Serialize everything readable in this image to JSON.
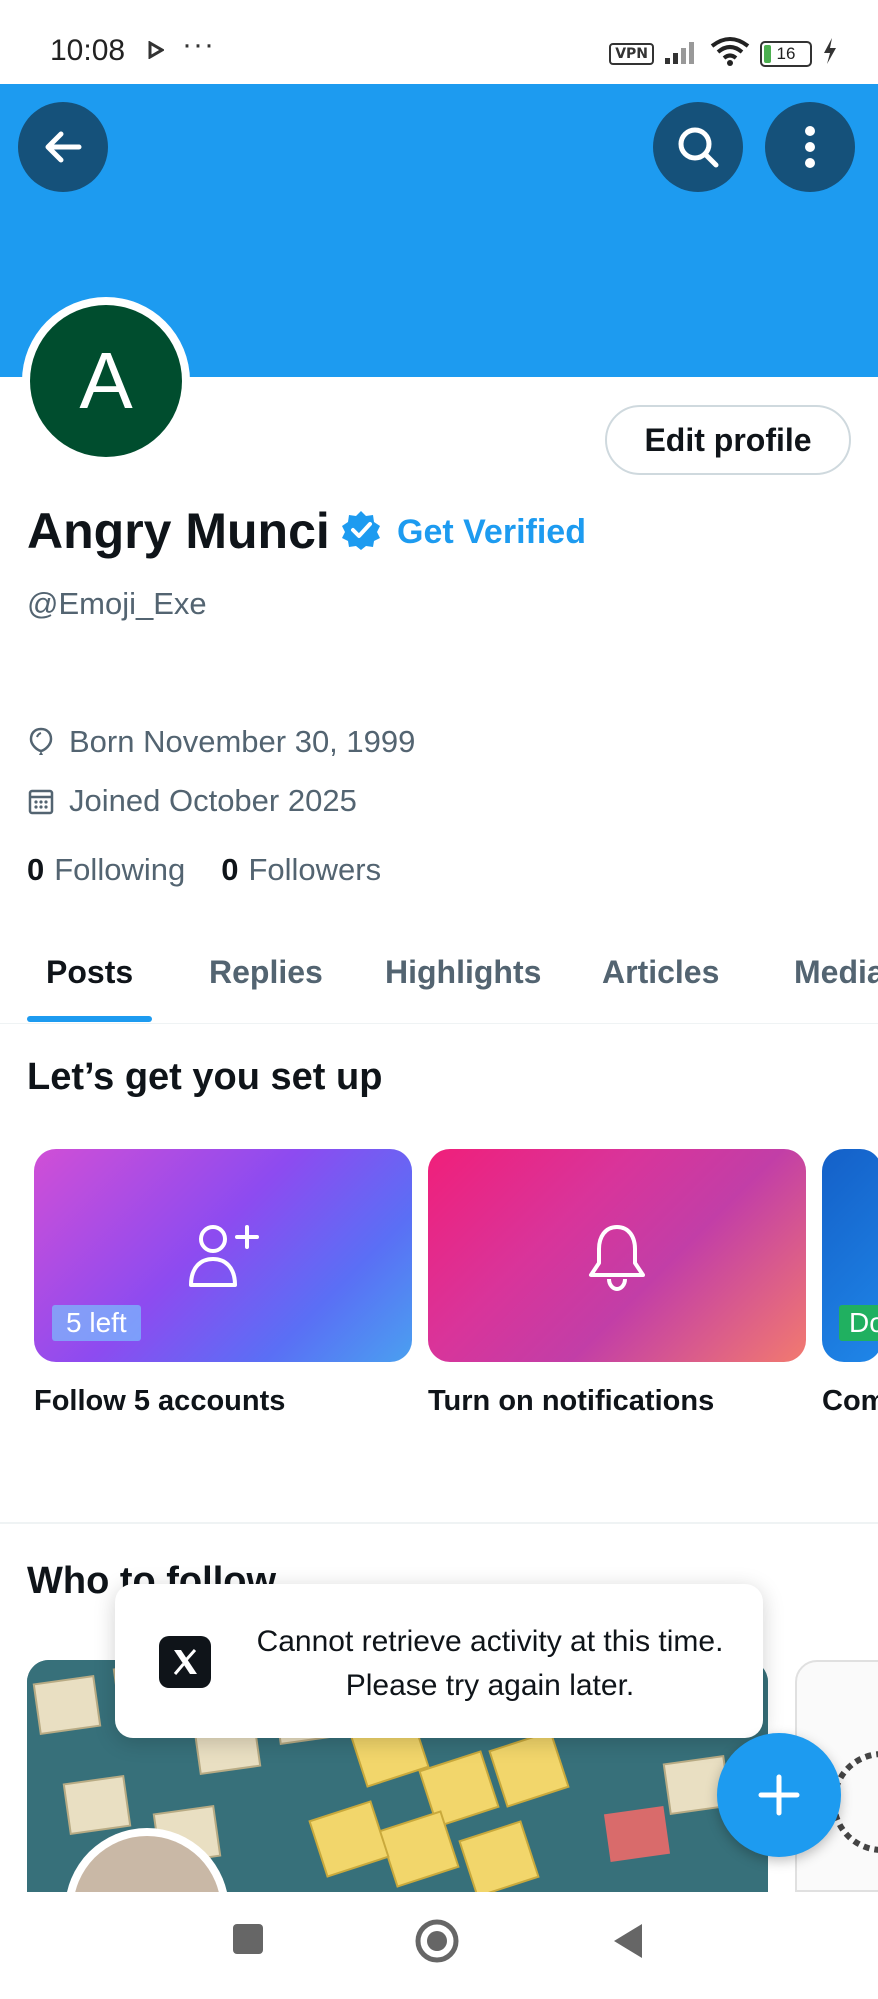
{
  "status_bar": {
    "time": "10:08",
    "more": "···",
    "vpn": "VPN",
    "battery_level": "16",
    "battery_fraction": 0.16
  },
  "profile": {
    "avatar_letter": "A",
    "avatar_color": "#004d2e",
    "banner_color": "#1d9bf0",
    "name": "Angry Munci",
    "get_verified": "Get Verified",
    "handle": "@Emoji_Exe",
    "born": "Born November 30, 1999",
    "joined": "Joined October 2025",
    "following_count": "0",
    "following_label": "Following",
    "followers_count": "0",
    "followers_label": "Followers",
    "edit_profile": "Edit profile"
  },
  "tabs": [
    {
      "label": "Posts",
      "active": true
    },
    {
      "label": "Replies",
      "active": false
    },
    {
      "label": "Highlights",
      "active": false
    },
    {
      "label": "Articles",
      "active": false
    },
    {
      "label": "Media",
      "active": false
    }
  ],
  "setup": {
    "title": "Let’s get you set up",
    "cards": [
      {
        "label": "Follow 5 accounts",
        "badge": "5 left",
        "icon": "add-person-icon"
      },
      {
        "label": "Turn on notifications",
        "badge": "",
        "icon": "bell-icon"
      },
      {
        "label": "Com",
        "badge": "Do",
        "icon": ""
      }
    ]
  },
  "who_to_follow": {
    "title": "Who to follow"
  },
  "toast": {
    "message": "Cannot retrieve activity at this time. Please try again later."
  },
  "colors": {
    "accent": "#1d9bf0",
    "text": "#0f1419",
    "muted": "#536471"
  }
}
